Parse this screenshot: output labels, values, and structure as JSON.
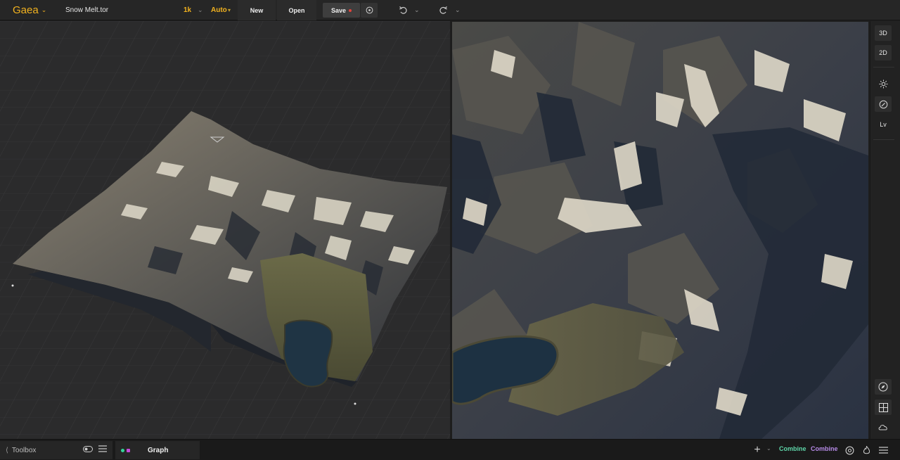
{
  "topbar": {
    "brand": "Gaea",
    "filename": "Snow Melt.tor",
    "resolution": "1k",
    "build_mode": "Auto",
    "new_label": "New",
    "open_label": "Open",
    "save_label": "Save"
  },
  "rail": {
    "view_3d": "3D",
    "view_2d": "2D",
    "lv": "Lv"
  },
  "bottombar": {
    "toolbox_label": "Toolbox",
    "graph_label": "Graph",
    "combine_a": "Combine",
    "combine_b": "Combine"
  },
  "colors": {
    "accent": "#f2b21f",
    "save_dirty": "#e0443c",
    "graph_dot_green": "#35d49a",
    "graph_dot_magenta": "#c34cd8",
    "combine_a": "#5fd6a9",
    "combine_b": "#b68ae6"
  }
}
